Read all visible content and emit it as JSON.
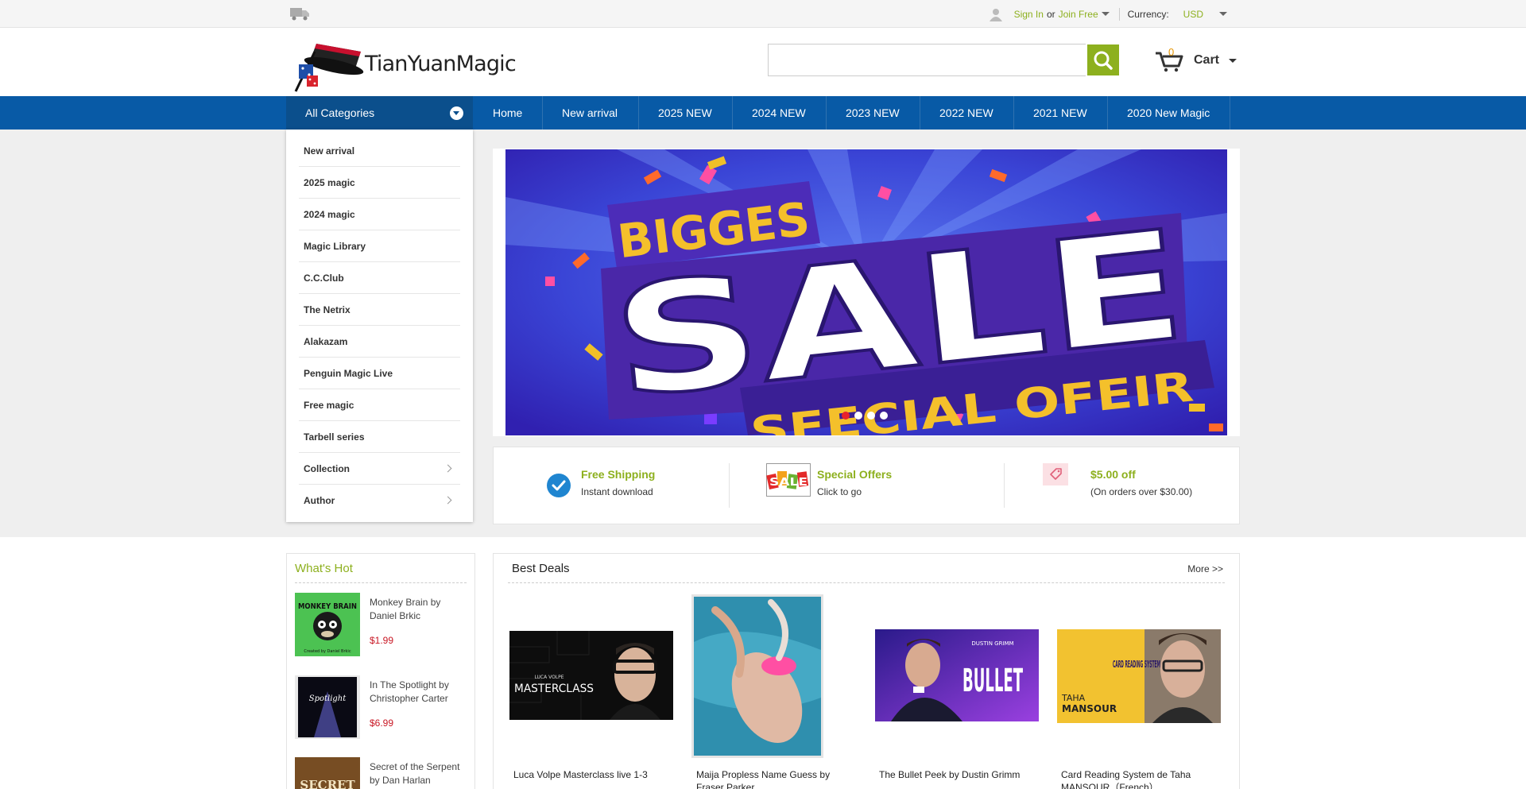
{
  "topbar": {
    "sign_in": "Sign In",
    "or": "or",
    "join": "Join Free",
    "currency_label": "Currency:",
    "currency_value": "USD"
  },
  "header": {
    "logo_text": "TianYuanMagic",
    "search_placeholder": "",
    "cart_count": "0",
    "cart_label": "Cart"
  },
  "nav": {
    "all_categories": "All Categories",
    "items": [
      "Home",
      "New arrival",
      "2025 NEW",
      "2024 NEW",
      "2023 NEW",
      "2022 NEW",
      "2021 NEW",
      "2020 New Magic"
    ]
  },
  "categories": [
    "New arrival",
    "2025 magic",
    "2024 magic",
    "Magic Library",
    "C.C.Club",
    "The Netrix",
    "Alakazam",
    "Penguin Magic Live",
    "Free magic",
    "Tarbell series",
    "Collection",
    "Author"
  ],
  "banner": {
    "line1": "BIGGES",
    "line2": "SALE",
    "line3": "SFECIAL OFEIR"
  },
  "features": [
    {
      "title": "Free Shipping",
      "sub": "Instant download"
    },
    {
      "title": "Special Offers",
      "sub": "Click to go",
      "badge": "SALE"
    },
    {
      "title": "$5.00 off",
      "sub": "(On orders over $30.00)"
    }
  ],
  "whats_hot": {
    "title": "What's Hot",
    "items": [
      {
        "name": "Monkey Brain by Daniel Brkic",
        "price": "$1.99",
        "img_text": "MONKEY BRAIN",
        "img_sub": "Created by Daniel Brkic"
      },
      {
        "name": "In The Spotlight by Christopher Carter",
        "price": "$6.99",
        "img_text": "Spotlight"
      },
      {
        "name": "Secret of the Serpent by Dan Harlan",
        "price": "",
        "img_text": "SECRET"
      }
    ]
  },
  "best_deals": {
    "title": "Best Deals",
    "more": "More >>",
    "items": [
      {
        "name": "Luca Volpe Masterclass live 1-3",
        "img_sub": "LUCA VOLPE",
        "img_text": "MASTERCLASS"
      },
      {
        "name": "Maija Propless Name Guess by Fraser Parker"
      },
      {
        "name": "The Bullet Peek by Dustin Grimm",
        "img_sub": "DUSTIN GRIMM",
        "img_text": "BULLET"
      },
      {
        "name": "Card Reading System de Taha MANSOUR（French）",
        "img_text": "CARD READING SYSTEM",
        "img_sub1": "TAHA",
        "img_sub2": "MANSOUR"
      }
    ]
  }
}
